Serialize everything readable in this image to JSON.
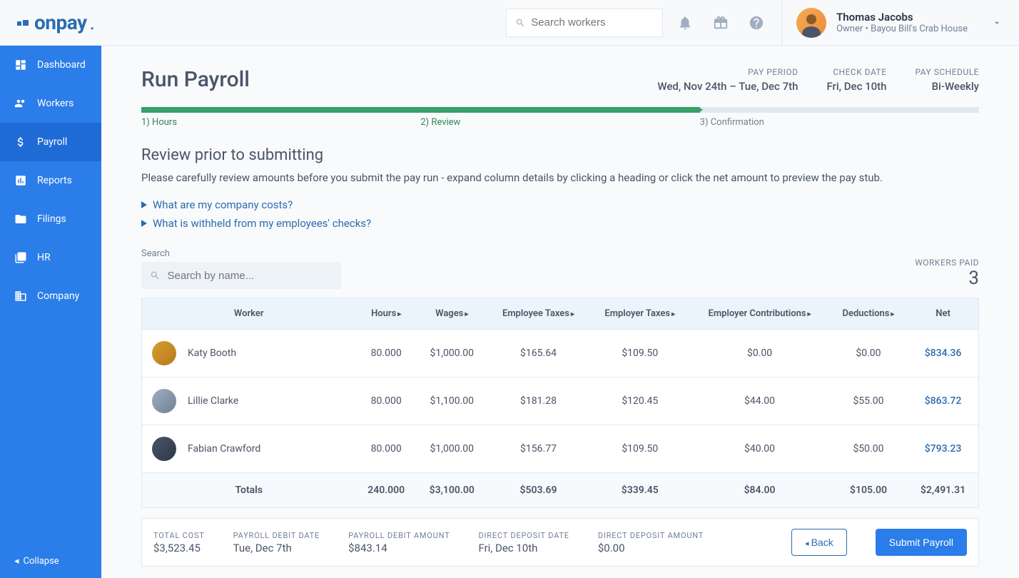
{
  "header": {
    "brand": "onpay",
    "search_placeholder": "Search workers",
    "user_name": "Thomas Jacobs",
    "user_role": "Owner • Bayou Bill's Crab House"
  },
  "sidebar": {
    "items": [
      {
        "label": "Dashboard"
      },
      {
        "label": "Workers"
      },
      {
        "label": "Payroll"
      },
      {
        "label": "Reports"
      },
      {
        "label": "Filings"
      },
      {
        "label": "HR"
      },
      {
        "label": "Company"
      }
    ],
    "collapse": "Collapse"
  },
  "page": {
    "title": "Run Payroll",
    "meta": {
      "pay_period_label": "PAY PERIOD",
      "pay_period_value": "Wed, Nov 24th – Tue, Dec 7th",
      "check_date_label": "CHECK DATE",
      "check_date_value": "Fri, Dec 10th",
      "pay_schedule_label": "PAY SCHEDULE",
      "pay_schedule_value": "Bi-Weekly"
    },
    "steps": [
      "1) Hours",
      "2) Review",
      "3) Confirmation"
    ],
    "section_title": "Review prior to submitting",
    "section_desc": "Please carefully review amounts before you submit the pay run - expand column details by clicking a heading or click the net amount to preview the pay stub.",
    "expand_links": [
      "What are my company costs?",
      "What is withheld from my employees' checks?"
    ],
    "search_label": "Search",
    "search_placeholder": "Search by name...",
    "workers_paid_label": "WORKERS PAID",
    "workers_paid_count": "3"
  },
  "table": {
    "columns": [
      "Worker",
      "Hours",
      "Wages",
      "Employee Taxes",
      "Employer Taxes",
      "Employer Contributions",
      "Deductions",
      "Net"
    ],
    "rows": [
      {
        "name": "Katy Booth",
        "hours": "80.000",
        "wages": "$1,000.00",
        "emp_taxes": "$165.64",
        "er_taxes": "$109.50",
        "er_contrib": "$0.00",
        "deductions": "$0.00",
        "net": "$834.36"
      },
      {
        "name": "Lillie Clarke",
        "hours": "80.000",
        "wages": "$1,100.00",
        "emp_taxes": "$181.28",
        "er_taxes": "$120.45",
        "er_contrib": "$44.00",
        "deductions": "$55.00",
        "net": "$863.72"
      },
      {
        "name": "Fabian Crawford",
        "hours": "80.000",
        "wages": "$1,000.00",
        "emp_taxes": "$156.77",
        "er_taxes": "$109.50",
        "er_contrib": "$40.00",
        "deductions": "$50.00",
        "net": "$793.23"
      }
    ],
    "totals": {
      "label": "Totals",
      "hours": "240.000",
      "wages": "$3,100.00",
      "emp_taxes": "$503.69",
      "er_taxes": "$339.45",
      "er_contrib": "$84.00",
      "deductions": "$105.00",
      "net": "$2,491.31"
    }
  },
  "footer": {
    "total_cost_label": "TOTAL COST",
    "total_cost_value": "$3,523.45",
    "debit_date_label": "PAYROLL DEBIT DATE",
    "debit_date_value": "Tue, Dec 7th",
    "debit_amount_label": "PAYROLL DEBIT AMOUNT",
    "debit_amount_value": "$843.14",
    "dd_date_label": "DIRECT DEPOSIT DATE",
    "dd_date_value": "Fri, Dec 10th",
    "dd_amount_label": "DIRECT DEPOSIT AMOUNT",
    "dd_amount_value": "$0.00",
    "back": "Back",
    "submit": "Submit Payroll"
  }
}
